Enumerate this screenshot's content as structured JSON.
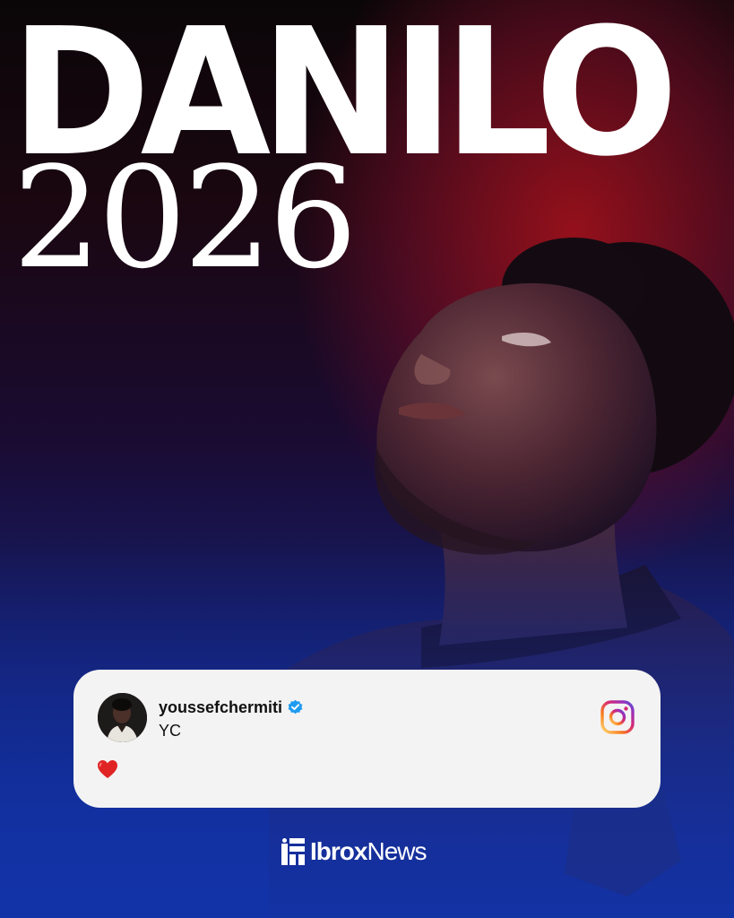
{
  "headline": {
    "name": "DANILO",
    "year": "2026"
  },
  "post": {
    "username": "youssefchermiti",
    "caption": "YC",
    "comment": "❤️",
    "verified_icon": "verified-badge-icon",
    "platform_icon": "instagram-icon"
  },
  "brand": {
    "name_part1": "Ibrox",
    "name_part2": "News"
  },
  "colors": {
    "background_top": "#0a0608",
    "background_red": "#aa121c",
    "background_bottom": "#1233a8",
    "card": "#f3f3f3",
    "verified": "#1d9bf0"
  }
}
